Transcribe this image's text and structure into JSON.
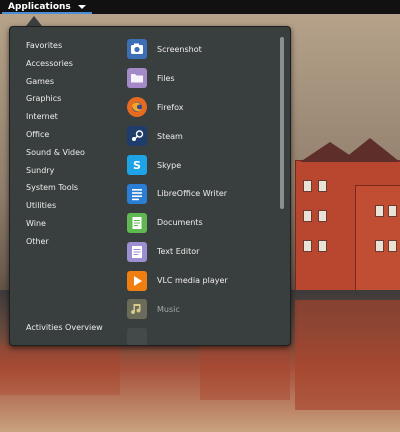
{
  "topbar": {
    "applications_label": "Applications",
    "caret_icon": "chevron-down-icon"
  },
  "menu": {
    "categories": [
      "Favorites",
      "Accessories",
      "Games",
      "Graphics",
      "Internet",
      "Office",
      "Sound & Video",
      "Sundry",
      "System Tools",
      "Utilities",
      "Wine",
      "Other"
    ],
    "activities_overview": "Activities Overview",
    "apps": [
      {
        "name": "Screenshot",
        "icon": "camera-icon",
        "color": "#3c6fb5"
      },
      {
        "name": "Files",
        "icon": "folder-icon",
        "color": "#a58ac9"
      },
      {
        "name": "Firefox",
        "icon": "firefox-icon",
        "color": "#e66a1f"
      },
      {
        "name": "Steam",
        "icon": "steam-icon",
        "color": "#1f3d6b"
      },
      {
        "name": "Skype",
        "icon": "skype-icon",
        "color": "#1ea3e6"
      },
      {
        "name": "LibreOffice Writer",
        "icon": "writer-icon",
        "color": "#2a7ed6"
      },
      {
        "name": "Documents",
        "icon": "documents-icon",
        "color": "#5fb852"
      },
      {
        "name": "Text Editor",
        "icon": "text-editor-icon",
        "color": "#9c8ed0"
      },
      {
        "name": "VLC media player",
        "icon": "vlc-icon",
        "color": "#f07f12"
      },
      {
        "name": "Music",
        "icon": "music-icon",
        "color": "#6b6b5a"
      }
    ]
  }
}
